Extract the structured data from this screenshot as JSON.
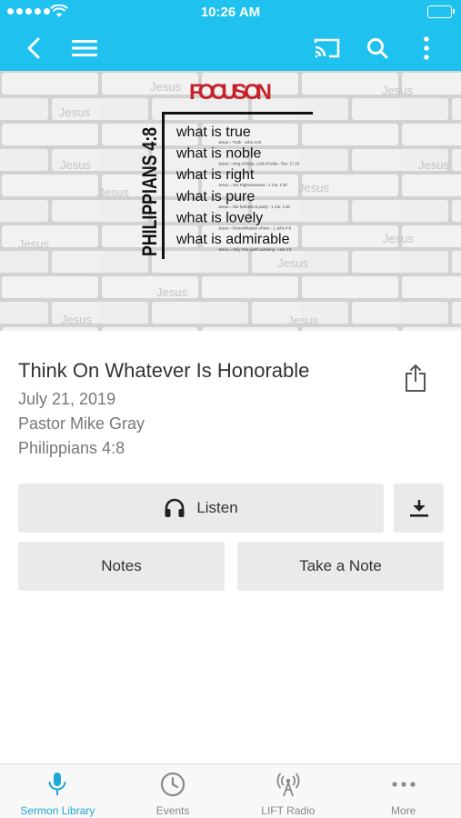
{
  "status_bar": {
    "time": "10:26 AM"
  },
  "hero": {
    "heading": "FOCUS ON",
    "reference": "PHILIPPIANS 4:8",
    "lines": [
      {
        "text": "what is true",
        "note": "Jesus = Truth - John 14:6"
      },
      {
        "text": "what is noble",
        "note": "Jesus = King of kings, Lord of lords - Rev. 17:16"
      },
      {
        "text": "what is right",
        "note": "Jesus = Our Righteousness - 1 Cor. 1:30"
      },
      {
        "text": "what is pure",
        "note": "Jesus = Our holiness & purity - 1 Cor. 1:30"
      },
      {
        "text": "what is lovely",
        "note": "Jesus = Personification of love - 1 John 4:8"
      },
      {
        "text": "what is admirable",
        "note": "Jesus = Only One worth admiring - Heb 3:3"
      }
    ],
    "watermark": "Jesus",
    "accent_color": "#c8202a"
  },
  "sermon": {
    "title": "Think On Whatever Is Honorable",
    "date": "July 21, 2019",
    "speaker": "Pastor Mike Gray",
    "scripture": "Philippians 4:8"
  },
  "actions": {
    "listen": "Listen",
    "notes": "Notes",
    "take_note": "Take a Note"
  },
  "tabs": [
    {
      "label": "Sermon Library",
      "icon": "microphone-icon",
      "active": true
    },
    {
      "label": "Events",
      "icon": "clock-icon",
      "active": false
    },
    {
      "label": "LIFT Radio",
      "icon": "radio-tower-icon",
      "active": false
    },
    {
      "label": "More",
      "icon": "more-dots-icon",
      "active": false
    }
  ],
  "colors": {
    "brand": "#1fc1ee",
    "active_tab": "#1fa8d8",
    "button_bg": "#e8eaeb"
  }
}
